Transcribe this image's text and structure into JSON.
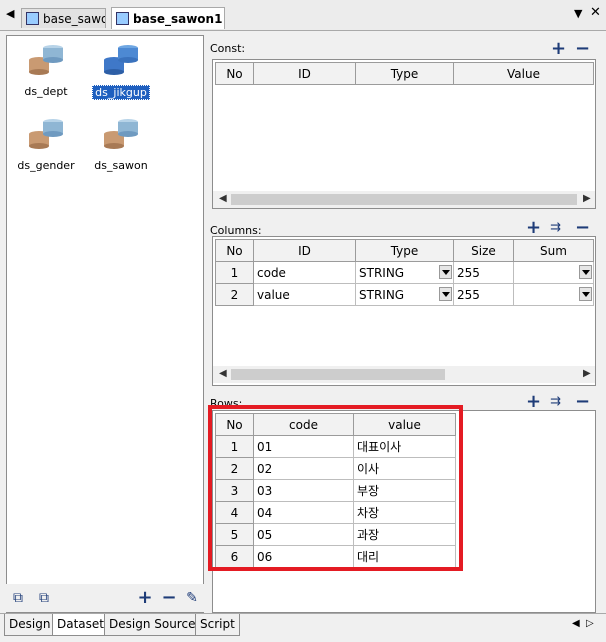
{
  "tabs": [
    {
      "label": "base_sawon"
    },
    {
      "label": "base_sawon1 *"
    }
  ],
  "datasets": [
    {
      "name": "ds_dept"
    },
    {
      "name": "ds_jikgup"
    },
    {
      "name": "ds_gender"
    },
    {
      "name": "ds_sawon"
    }
  ],
  "const": {
    "label": "Const:",
    "headers": [
      "No",
      "ID",
      "Type",
      "Value"
    ]
  },
  "columns": {
    "label": "Columns:",
    "headers": [
      "No",
      "ID",
      "Type",
      "Size",
      "Sum"
    ],
    "rows": [
      {
        "no": "1",
        "id": "code",
        "type": "STRING",
        "size": "255"
      },
      {
        "no": "2",
        "id": "value",
        "type": "STRING",
        "size": "255"
      }
    ]
  },
  "rows_section": {
    "label": "Rows:",
    "headers": [
      "No",
      "code",
      "value"
    ],
    "rows": [
      {
        "no": "1",
        "code": "01",
        "value": "대표이사"
      },
      {
        "no": "2",
        "code": "02",
        "value": "이사"
      },
      {
        "no": "3",
        "code": "03",
        "value": "부장"
      },
      {
        "no": "4",
        "code": "04",
        "value": "차장"
      },
      {
        "no": "5",
        "code": "05",
        "value": "과장"
      },
      {
        "no": "6",
        "code": "06",
        "value": "대리"
      }
    ]
  },
  "bottom_tabs": [
    {
      "label": "Design"
    },
    {
      "label": "Dataset"
    },
    {
      "label": "Design Source"
    },
    {
      "label": "Script"
    }
  ],
  "colors": {
    "highlight": "#e41b23",
    "selection": "#1e5fbf"
  }
}
